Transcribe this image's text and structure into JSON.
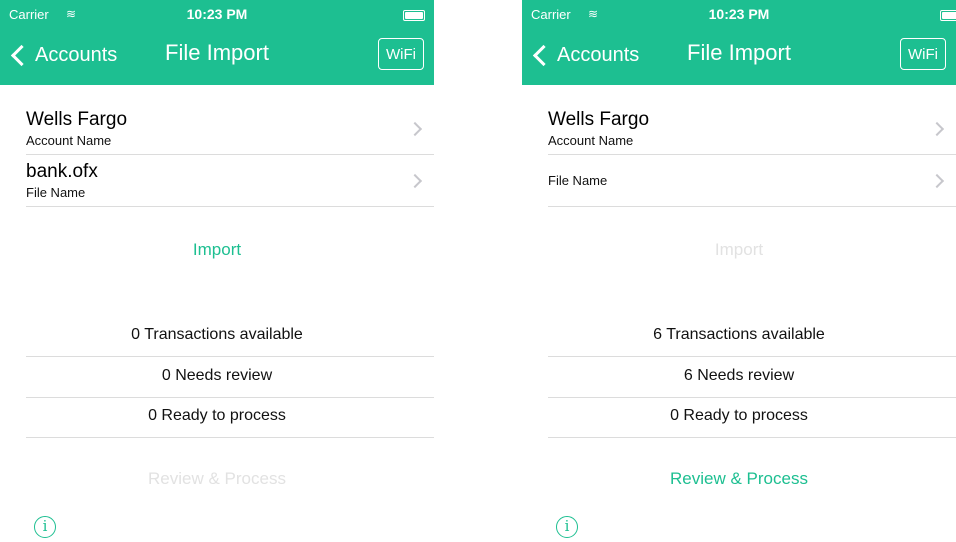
{
  "screens": [
    {
      "status": {
        "carrier": "Carrier",
        "time": "10:23 PM"
      },
      "nav": {
        "back_label": "Accounts",
        "title": "File Import",
        "wifi_label": "WiFi"
      },
      "account": {
        "value": "Wells Fargo",
        "caption": "Account Name"
      },
      "file": {
        "value": "bank.ofx",
        "caption": "File Name"
      },
      "import_label": "Import",
      "import_enabled": true,
      "stats": {
        "transactions": "0 Transactions available",
        "needs_review": "0 Needs review",
        "ready": "0 Ready to process"
      },
      "review_label": "Review & Process",
      "review_enabled": false,
      "info_icon": "i"
    },
    {
      "status": {
        "carrier": "Carrier",
        "time": "10:23 PM"
      },
      "nav": {
        "back_label": "Accounts",
        "title": "File Import",
        "wifi_label": "WiFi"
      },
      "account": {
        "value": "Wells Fargo",
        "caption": "Account Name"
      },
      "file": {
        "value": "",
        "caption": "File Name"
      },
      "import_label": "Import",
      "import_enabled": false,
      "stats": {
        "transactions": "6 Transactions available",
        "needs_review": "6 Needs review",
        "ready": "0 Ready to process"
      },
      "review_label": "Review & Process",
      "review_enabled": true,
      "info_icon": "i"
    }
  ],
  "colors": {
    "accent": "#1dbf91",
    "disabled": "#e2e2e2",
    "separator": "#dcdcdc"
  }
}
